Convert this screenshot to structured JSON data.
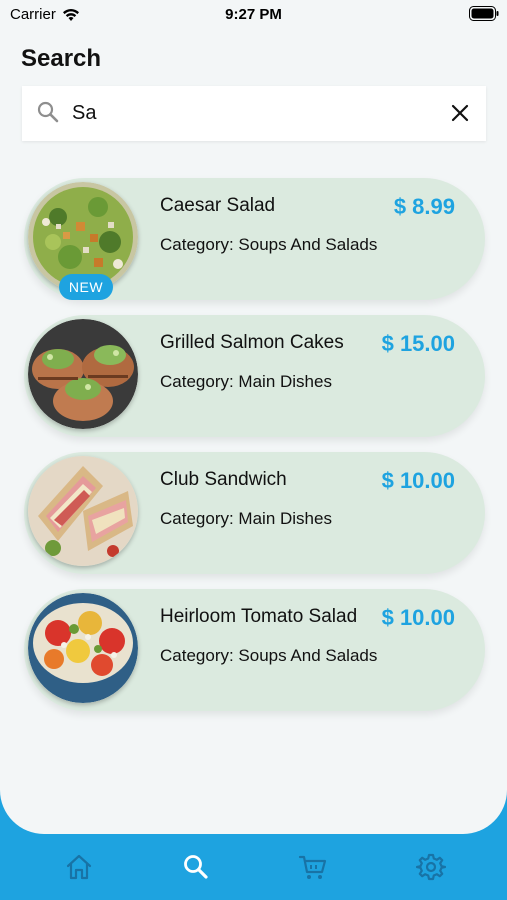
{
  "status_bar": {
    "carrier": "Carrier",
    "time": "9:27 PM"
  },
  "page_title": "Search",
  "search": {
    "value": "Sa",
    "placeholder": ""
  },
  "results": [
    {
      "name": "Caesar Salad",
      "price": "$ 8.99",
      "category": "Category: Soups And Salads",
      "badge": "NEW"
    },
    {
      "name": "Grilled Salmon Cakes",
      "price": "$ 15.00",
      "category": "Category: Main Dishes",
      "badge": ""
    },
    {
      "name": "Club Sandwich",
      "price": "$ 10.00",
      "category": "Category: Main Dishes",
      "badge": ""
    },
    {
      "name": "Heirloom Tomato Salad",
      "price": "$ 10.00",
      "category": "Category: Soups And Salads",
      "badge": ""
    }
  ],
  "tabs": [
    {
      "icon": "home-icon",
      "active": false
    },
    {
      "icon": "search-icon",
      "active": true
    },
    {
      "icon": "cart-icon",
      "active": false
    },
    {
      "icon": "gear-icon",
      "active": false
    }
  ],
  "colors": {
    "accent": "#1ea3e0",
    "card_bg": "#dbeadf",
    "screen_bg": "#f3f6f7",
    "tab_icon_inactive": "#1873a6",
    "tab_icon_active": "#ffffff"
  }
}
